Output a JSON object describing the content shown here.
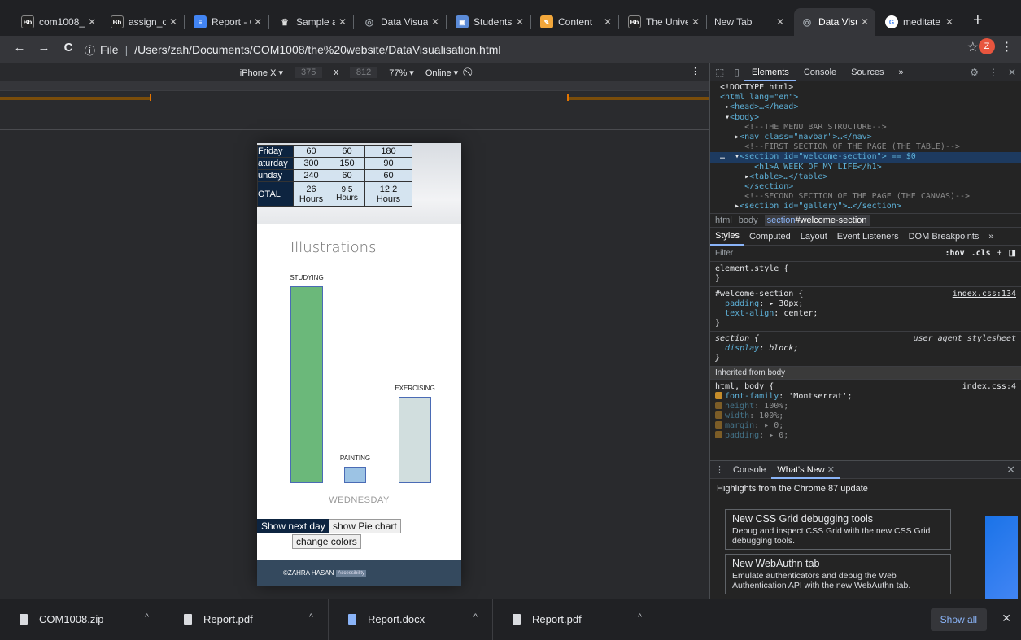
{
  "tabs": [
    {
      "favicon": "Bb",
      "favcolor": "#222",
      "title": "com1008_"
    },
    {
      "favicon": "Bb",
      "favcolor": "#222",
      "title": "assign_ov"
    },
    {
      "favicon": "doc",
      "favcolor": "#4285f4",
      "title": "Report - C"
    },
    {
      "favicon": "crown",
      "favcolor": "#444",
      "title": "Sample ac"
    },
    {
      "favicon": "globe",
      "favcolor": "#5f6368",
      "title": "Data Visua"
    },
    {
      "favicon": "S",
      "favcolor": "#5b8bd8",
      "title": "Students"
    },
    {
      "favicon": "pen",
      "favcolor": "#f2a73b",
      "title": "Content"
    },
    {
      "favicon": "Bb",
      "favcolor": "#222",
      "title": "The Unive"
    },
    {
      "favicon": "",
      "favcolor": "transparent",
      "title": "New Tab"
    },
    {
      "favicon": "globe",
      "favcolor": "#5f6368",
      "title": "Data Visu"
    },
    {
      "favicon": "G",
      "favcolor": "#fff",
      "title": "meditate"
    }
  ],
  "toolbar": {
    "back": "←",
    "forward": "→",
    "reload": "C",
    "info": "ⓘ",
    "scheme": "File",
    "path": "/Users/zah/Documents/COM1008/the%20website/DataVisualisation.html",
    "profile": "Z"
  },
  "device": {
    "name": "iPhone X ▾",
    "width": "375",
    "x": "x",
    "height": "812",
    "zoom": "77% ▾",
    "network": "Online ▾",
    "kebab": "⋮"
  },
  "page": {
    "schedule": [
      [
        "Friday",
        "60",
        "60",
        "180"
      ],
      [
        "aturday",
        "300",
        "150",
        "90"
      ],
      [
        "unday",
        "240",
        "60",
        "60"
      ],
      [
        "OTAL",
        "26 Hours",
        "9.5 Hours",
        "12.2 Hours"
      ]
    ],
    "illustrations_title": "Illustrations",
    "chart_data": {
      "type": "bar",
      "categories": [
        "STUDYING",
        "PAINTING",
        "EXERCISING"
      ],
      "values": [
        240,
        20,
        105
      ],
      "colors": [
        "#6bb87a",
        "#9cc3e4",
        "#d1dede"
      ],
      "xlabel": "WEDNESDAY"
    },
    "buttons": {
      "next": "Show next day",
      "pie": "show Pie chart",
      "colors": "change colors"
    },
    "footer": {
      "text": "©ZAHRA HASAN",
      "badge": "Accessibility"
    }
  },
  "devtools": {
    "tabs": [
      "Elements",
      "Console",
      "Sources",
      "»"
    ],
    "dom": {
      "doctype": "<!DOCTYPE html>",
      "html_open": "<html lang=\"en\">",
      "head": "<head>…</head>",
      "body": "<body>",
      "c1": "<!--THE MENU BAR STRUCTURE-->",
      "nav": "<nav class=\"navbar\">…</nav>",
      "c2": "<!--FIRST SECTION OF THE PAGE (THE TABLE)-->",
      "section": "<section id=\"welcome-section\"> == $0",
      "h1": "<h1>A WEEK OF MY LIFE</h1>",
      "table": "<table>…</table>",
      "section_close": "</section>",
      "c3": "<!--SECOND SECTION OF THE PAGE (THE CANVAS)-->",
      "cut": "<section id=\"gallery\">…</section>"
    },
    "crumbs": [
      "html",
      "body",
      "section",
      "#welcome-section"
    ],
    "style_tabs": [
      "Styles",
      "Computed",
      "Layout",
      "Event Listeners",
      "DOM Breakpoints",
      "»"
    ],
    "filter": {
      "placeholder": "Filter",
      "hov": ":hov",
      "cls": ".cls",
      "plus": "+"
    },
    "rules": {
      "element_style": "element.style {",
      "welcome_sel": "#welcome-section {",
      "welcome_src": "index.css:134",
      "padding_name": "padding",
      "padding_val": "▸ 30px;",
      "align_name": "text-align",
      "align_val": "center;",
      "section_sel": "section {",
      "section_src": "user agent stylesheet",
      "display_name": "display",
      "display_val": "block;",
      "inherited": "Inherited from body",
      "body_sel": "html, body {",
      "body_src": "index.css:4",
      "ff_name": "font-family",
      "ff_val": "'Montserrat';",
      "h_name": "height",
      "h_val": "100%;",
      "w_name": "width",
      "w_val": "100%;",
      "m_name": "margin",
      "m_val": "▸ 0;",
      "p_name": "padding",
      "p_val": "▸ 0;"
    },
    "drawer": {
      "tabs": [
        "Console",
        "What's New"
      ],
      "highlights": "Highlights from the Chrome 87 update",
      "cards": [
        {
          "title": "New CSS Grid debugging tools",
          "desc": "Debug and inspect CSS Grid with the new CSS Grid debugging tools."
        },
        {
          "title": "New WebAuthn tab",
          "desc": "Emulate authenticators and debug the Web Authentication API with the new WebAuthn tab."
        }
      ]
    }
  },
  "downloads": {
    "items": [
      "COM1008.zip",
      "Report.pdf",
      "Report.docx",
      "Report.pdf"
    ],
    "show_all": "Show all"
  }
}
